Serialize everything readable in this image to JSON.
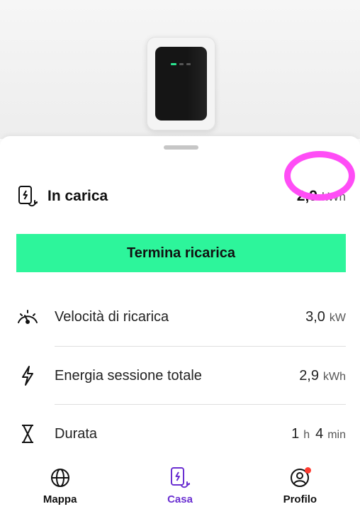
{
  "status": {
    "title": "In carica",
    "energy_value": "2,9",
    "energy_unit": "kWh"
  },
  "action": {
    "stop_label": "Termina ricarica"
  },
  "metrics": [
    {
      "label": "Velocità di ricarica",
      "value": "3,0",
      "unit": "kW",
      "icon": "speedometer-icon"
    },
    {
      "label": "Energia sessione totale",
      "value": "2,9",
      "unit": "kWh",
      "icon": "lightning-icon"
    },
    {
      "label": "Durata",
      "hours": "1",
      "hours_unit": "h",
      "minutes": "4",
      "minutes_unit": "min",
      "icon": "hourglass-icon"
    }
  ],
  "tabs": [
    {
      "label": "Mappa",
      "icon": "globe-icon",
      "active": false
    },
    {
      "label": "Casa",
      "icon": "home-charger-icon",
      "active": true
    },
    {
      "label": "Profilo",
      "icon": "profile-icon",
      "active": false,
      "notification": true
    }
  ],
  "colors": {
    "accent_green": "#2df59b",
    "active_tab": "#6a2fd1",
    "annotation": "#ff4df6",
    "notification": "#ff3b30"
  }
}
